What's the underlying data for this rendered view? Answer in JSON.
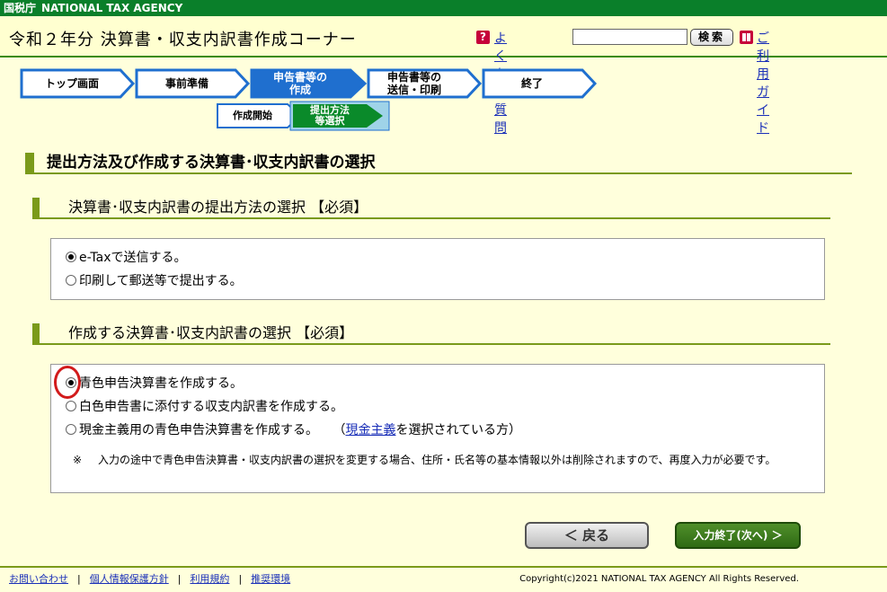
{
  "topbar": {
    "agency_jp": "国税庁",
    "agency_en": "NATIONAL TAX AGENCY"
  },
  "header": {
    "title": "令和２年分 決算書・収支内訳書作成コーナー",
    "faq_label": "よくある質問",
    "search_button": "検索",
    "guide_label": "ご利用ガイド",
    "search_value": ""
  },
  "steps": [
    {
      "label": "トップ画面",
      "state": "default"
    },
    {
      "label": "事前準備",
      "state": "default"
    },
    {
      "label": "申告書等の\n作成",
      "state": "active"
    },
    {
      "label": "申告書等の\n送信・印刷",
      "state": "default"
    },
    {
      "label": "終了",
      "state": "default"
    }
  ],
  "substeps": [
    {
      "label": "作成開始",
      "state": "default"
    },
    {
      "label": "提出方法\n等選択",
      "state": "current"
    }
  ],
  "main": {
    "title": "提出方法及び作成する決算書･収支内訳書の選択",
    "submission": {
      "title": "決算書･収支内訳書の提出方法の選択 【必須】",
      "options": [
        {
          "label": "e-Taxで送信する。",
          "selected": true
        },
        {
          "label": "印刷して郵送等で提出する。",
          "selected": false
        }
      ]
    },
    "document": {
      "title": "作成する決算書･収支内訳書の選択 【必須】",
      "options": [
        {
          "label": "青色申告決算書を作成する。",
          "selected": true
        },
        {
          "label": "白色申告書に添付する収支内訳書を作成する。",
          "selected": false
        },
        {
          "label": "現金主義用の青色申告決算書を作成する。",
          "selected": false
        }
      ],
      "cash_note_open": "（",
      "cash_link": "現金主義",
      "cash_note_close": "を選択されている方）",
      "note_mark": "※",
      "note": "入力の途中で青色申告決算書・収支内訳書の選択を変更する場合、住所・氏名等の基本情報以外は削除されますので、再度入力が必要です。"
    }
  },
  "buttons": {
    "back": "＜ 戻る",
    "next": "入力終了(次へ) ＞"
  },
  "footer": {
    "links": [
      "お問い合わせ",
      "個人情報保護方針",
      "利用規約",
      "推奨環境"
    ],
    "copyright": "Copyright(c)2021 NATIONAL TAX AGENCY All Rights Reserved."
  },
  "colors": {
    "brand_green": "#0a7f2a",
    "step_blue": "#1f6fcf",
    "accent_olive": "#7a9a1a",
    "highlight_red": "#d21b1b"
  }
}
